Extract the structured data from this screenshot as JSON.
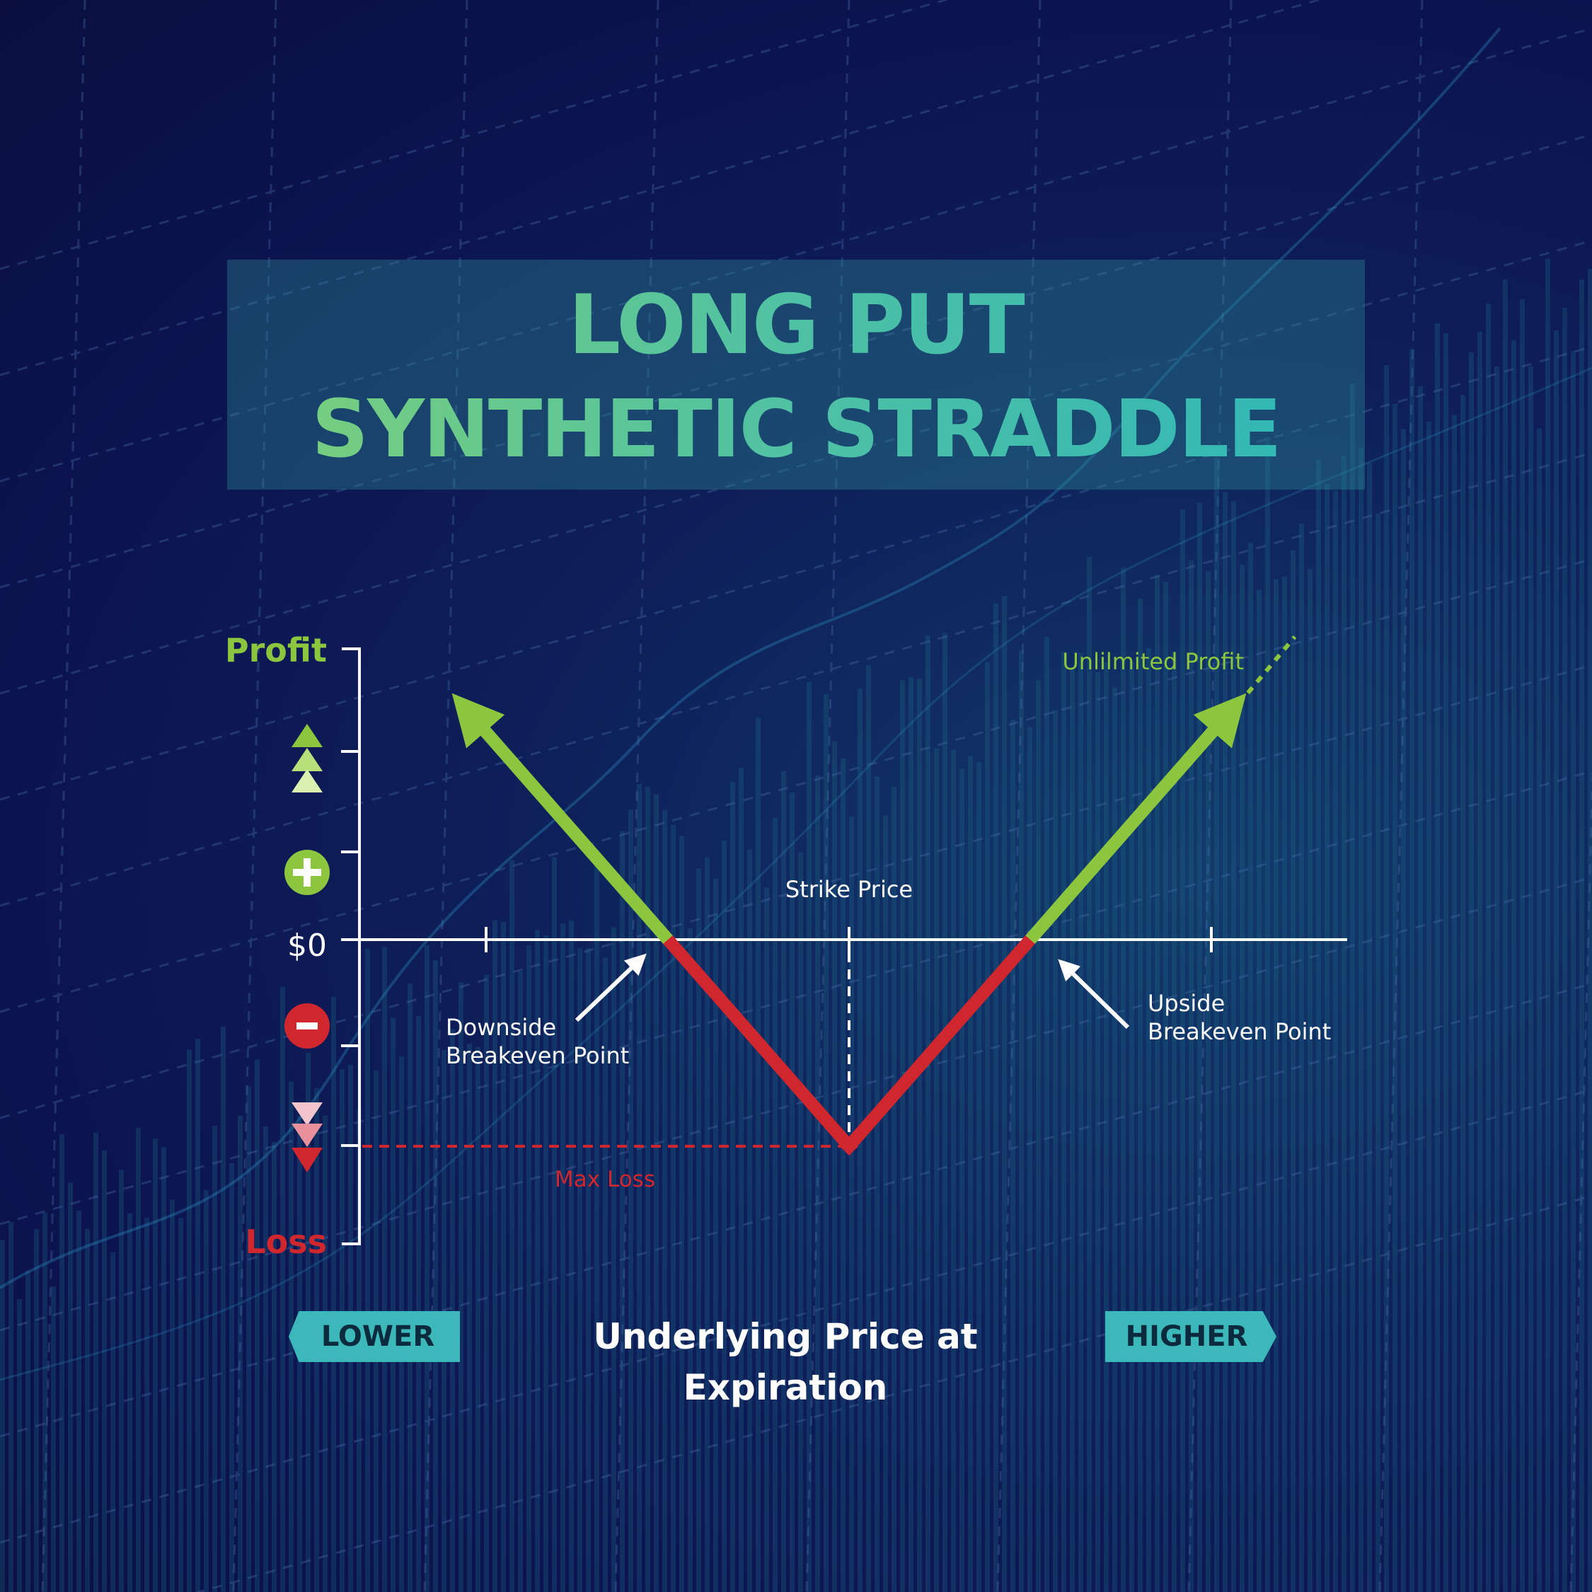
{
  "title": {
    "line1": "LONG PUT",
    "line2": "SYNTHETIC STRADDLE"
  },
  "axis": {
    "profit_label": "Profit",
    "loss_label": "Loss",
    "zero_label": "$0",
    "x_title": "Underlying Price at Expiration",
    "lower_tag": "LOWER",
    "higher_tag": "HIGHER"
  },
  "annotations": {
    "strike_price": "Strike Price",
    "downside_line1": "Downside",
    "downside_line2": "Breakeven Point",
    "upside_line1": "Upside",
    "upside_line2": "Breakeven Point",
    "max_loss": "Max Loss",
    "unlimited_profit": "Unlilmited Profit"
  },
  "colors": {
    "profit": "#8cc63f",
    "loss": "#d0272e",
    "axis": "#ffffff",
    "title_box": "#2d8c96",
    "tag": "#3cb8ba"
  },
  "icons": {
    "profit_up": "triple-up-triangle-icon",
    "plus": "plus-circle-icon",
    "minus": "minus-circle-icon",
    "loss_down": "triple-down-triangle-icon"
  },
  "chart_data": {
    "type": "line",
    "title": "LONG PUT SYNTHETIC STRADDLE",
    "xlabel": "Underlying Price at Expiration",
    "ylabel": "",
    "x_direction": [
      "LOWER",
      "HIGHER"
    ],
    "y_range_labels": [
      "Loss",
      "$0",
      "Profit"
    ],
    "strike": 0,
    "downside_breakeven": -1,
    "upside_breakeven": 1,
    "max_loss": -1,
    "series": [
      {
        "values": [
          [
            -2.1,
            1.1
          ],
          [
            -1,
            0
          ],
          [
            0,
            -1
          ],
          [
            1,
            0
          ],
          [
            2.1,
            1.1
          ]
        ]
      }
    ],
    "xlim": [
      -2.7,
      2.7
    ],
    "ylim": [
      -1.5,
      1.5
    ],
    "grid": false
  }
}
